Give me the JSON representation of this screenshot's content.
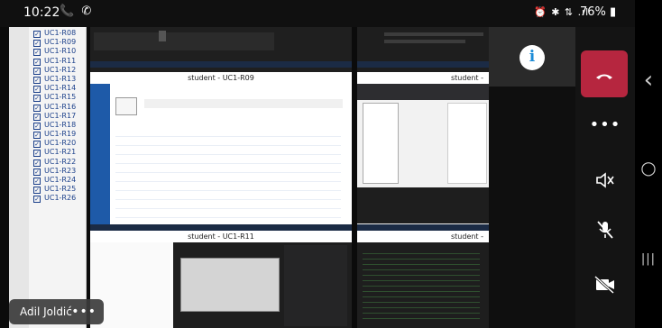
{
  "status_bar": {
    "time": "10:22",
    "call_icons": "📞 ✆",
    "system_icons": "⏰ ✱ ⇅ .ıl",
    "battery": "76%"
  },
  "left_list": {
    "items": [
      "UC1-R08",
      "UC1-R09",
      "UC1-R10",
      "UC1-R11",
      "UC1-R12",
      "UC1-R13",
      "UC1-R14",
      "UC1-R15",
      "UC1-R16",
      "UC1-R17",
      "UC1-R18",
      "UC1-R19",
      "UC1-R20",
      "UC1-R21",
      "UC1-R22",
      "UC1-R23",
      "UC1-R24",
      "UC1-R25",
      "UC1-R26"
    ]
  },
  "tiles": {
    "r09_caption": "student - UC1-R09",
    "r10_caption": "student -",
    "r11_caption": "student - UC1-R11",
    "r12_caption": "student -"
  },
  "participant": {
    "logo_letter": "i"
  },
  "controls": {
    "end_call_icon": "phone-hangup-icon",
    "more_icon": "more-icon",
    "speaker_icon": "speaker-mute-icon",
    "mic_icon": "mic-off-icon",
    "camera_icon": "camera-off-icon"
  },
  "presenter": {
    "name": "Adil Joldić",
    "more": "•••"
  },
  "nav": {
    "back": "‹",
    "home": "○",
    "recents": "|||"
  },
  "colors": {
    "end_call": "#b6263f",
    "list_text": "#1a3f8a"
  }
}
